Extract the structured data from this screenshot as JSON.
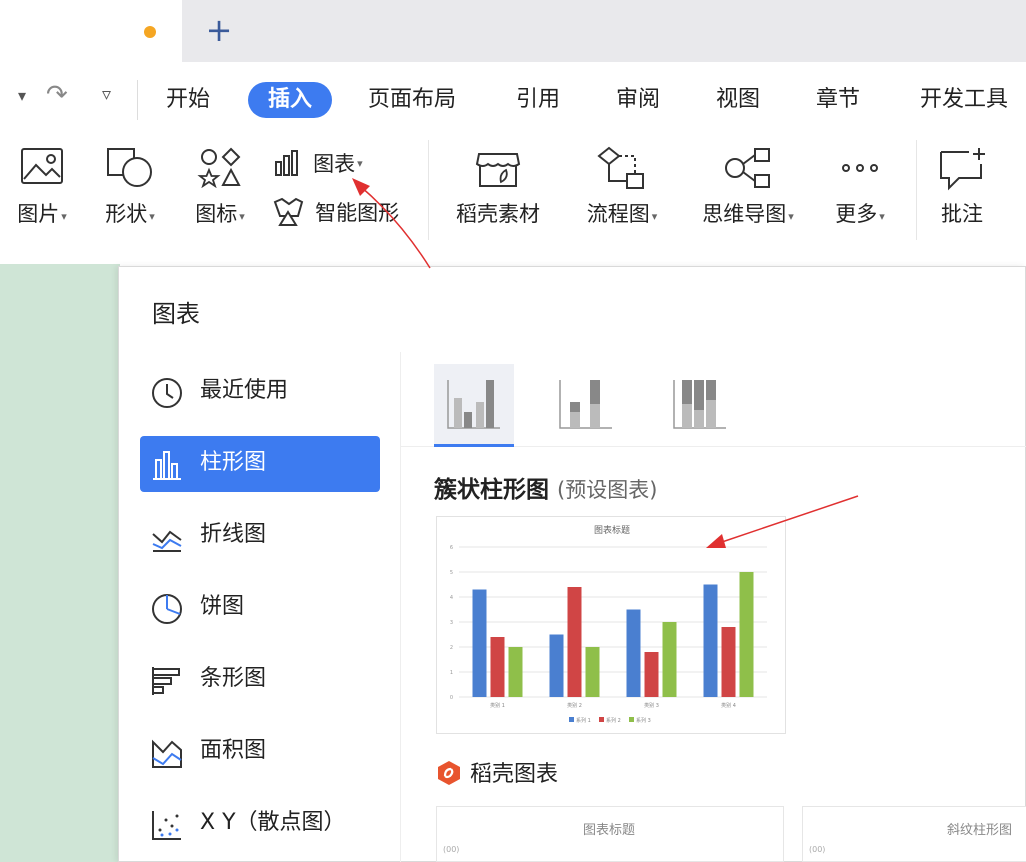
{
  "tabbar": {
    "new_tab": "+"
  },
  "quick_access": {
    "dropdown": "▾",
    "redo": "↷",
    "more": "▿"
  },
  "menu": {
    "items": [
      "开始",
      "插入",
      "页面布局",
      "引用",
      "审阅",
      "视图",
      "章节",
      "开发工具"
    ],
    "active": "插入"
  },
  "ribbon": {
    "picture": "图片",
    "shape": "形状",
    "icon": "图标",
    "chart": "图表",
    "smart_shape": "智能图形",
    "docer_material": "稻壳素材",
    "flowchart": "流程图",
    "mindmap": "思维导图",
    "more": "更多",
    "comment": "批注",
    "caret": "▾"
  },
  "dialog": {
    "title": "图表",
    "categories": [
      "最近使用",
      "柱形图",
      "折线图",
      "饼图",
      "条形图",
      "面积图",
      "X Y（散点图）"
    ],
    "active_category": "柱形图",
    "section_title": "簇状柱形图",
    "section_sub": "(预设图表)",
    "docer_title": "稻壳图表",
    "templates": [
      "图表标题",
      "斜纹柱形图"
    ],
    "template_tick": "(00)"
  },
  "chart_data": {
    "type": "bar",
    "categories": [
      "类别 1",
      "类别 2",
      "类别 3",
      "类别 4"
    ],
    "series": [
      {
        "name": "系列 1",
        "values": [
          4.3,
          2.5,
          3.5,
          4.5
        ],
        "color": "#4a7fd0"
      },
      {
        "name": "系列 2",
        "values": [
          2.4,
          4.4,
          1.8,
          2.8
        ],
        "color": "#d04545"
      },
      {
        "name": "系列 3",
        "values": [
          2.0,
          2.0,
          3.0,
          5.0
        ],
        "color": "#8fbf4a"
      }
    ],
    "title": "图表标题",
    "ylim": [
      0,
      6
    ],
    "y_ticks": [
      "0",
      "1",
      "2",
      "3",
      "4",
      "5",
      "6"
    ],
    "grid": true,
    "legend": "bottom"
  },
  "colors": {
    "accent": "#3d7bf0",
    "tab_dot": "#f5a623",
    "arrow": "#e03030",
    "doc_bg": "#cfe5d6"
  }
}
